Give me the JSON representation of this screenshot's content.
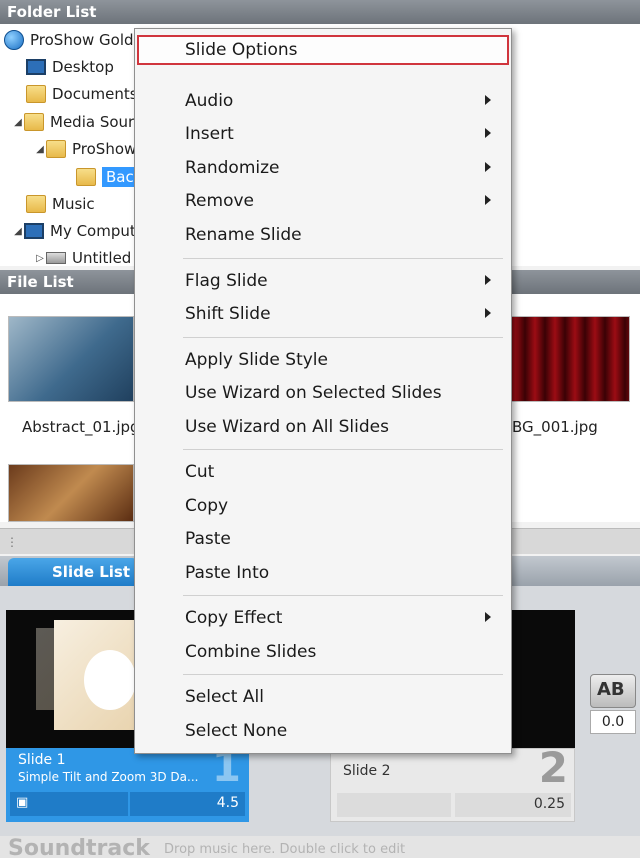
{
  "folder_list": {
    "header": "Folder List",
    "items": [
      {
        "label": "ProShow Gold",
        "icon": "globe-icon"
      },
      {
        "label": "Desktop",
        "icon": "desktop-icon"
      },
      {
        "label": "Documents",
        "icon": "folder-icon"
      },
      {
        "label": "Media Sources",
        "icon": "folder-icon"
      },
      {
        "label": "ProShow",
        "icon": "folder-icon"
      },
      {
        "label": "Backgrounds",
        "icon": "folder-icon"
      },
      {
        "label": "Music",
        "icon": "folder-icon"
      },
      {
        "label": "My Computer",
        "icon": "computer-icon"
      },
      {
        "label": "Untitled",
        "icon": "drive-icon"
      }
    ]
  },
  "file_list": {
    "header": "File List",
    "files": [
      "Abstract_01.jpg",
      "BG_001.jpg"
    ]
  },
  "slide_list": {
    "tab_label": "Slide List",
    "slides": [
      {
        "title": "Slide 1",
        "subtitle": "Simple Tilt and Zoom 3D Da...",
        "number": "1",
        "duration": "4.5"
      },
      {
        "title": "Slide 2",
        "number": "2",
        "duration": "0.25"
      }
    ],
    "transition_value": "0.0",
    "transition_icon_text": "AB"
  },
  "soundtrack": {
    "label": "Soundtrack",
    "hint": "Drop music here.  Double click to edit"
  },
  "context_menu": {
    "items": [
      {
        "label": "Slide Options",
        "submenu": false
      },
      {
        "label": "Audio",
        "submenu": true
      },
      {
        "label": "Insert",
        "submenu": true
      },
      {
        "label": "Randomize",
        "submenu": true
      },
      {
        "label": "Remove",
        "submenu": true
      },
      {
        "label": "Rename Slide",
        "submenu": false
      },
      {
        "label": "Flag Slide",
        "submenu": true
      },
      {
        "label": "Shift Slide",
        "submenu": true
      },
      {
        "label": "Apply Slide Style",
        "submenu": false
      },
      {
        "label": "Use Wizard on Selected Slides",
        "submenu": false
      },
      {
        "label": "Use Wizard on All Slides",
        "submenu": false
      },
      {
        "label": "Cut",
        "submenu": false
      },
      {
        "label": "Copy",
        "submenu": false
      },
      {
        "label": "Paste",
        "submenu": false
      },
      {
        "label": "Paste Into",
        "submenu": false
      },
      {
        "label": "Copy Effect",
        "submenu": true
      },
      {
        "label": "Combine Slides",
        "submenu": false
      },
      {
        "label": "Select All",
        "submenu": false
      },
      {
        "label": "Select None",
        "submenu": false
      }
    ]
  },
  "colors": {
    "highlight_border": "#d0353d",
    "selection_blue": "#3399ff",
    "slide_active": "#2f97e6"
  }
}
